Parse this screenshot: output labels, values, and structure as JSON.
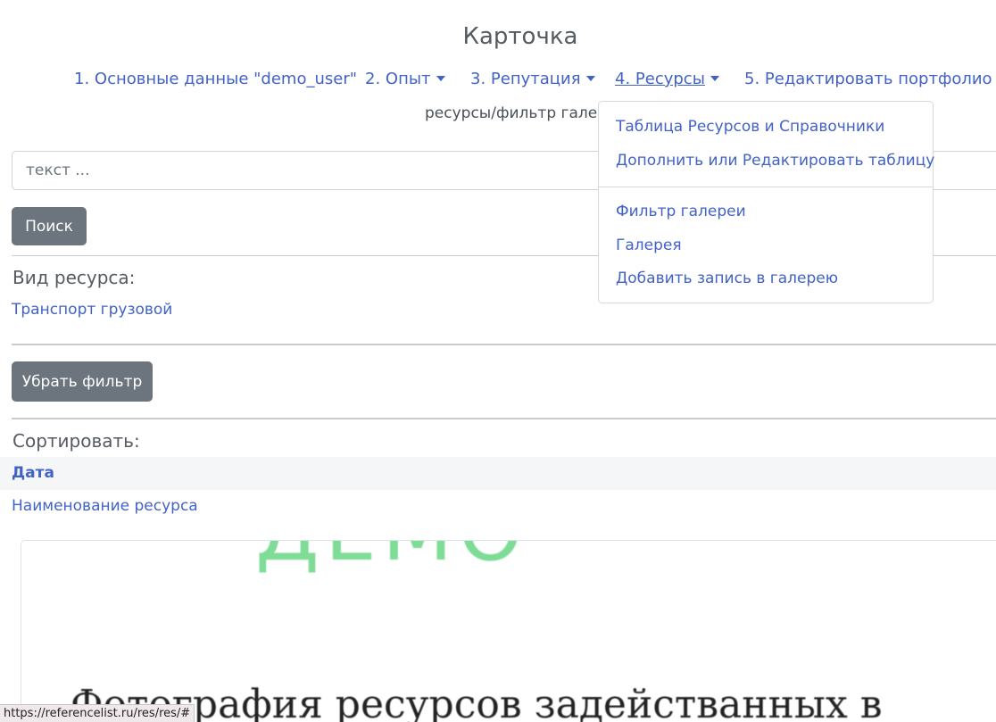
{
  "page": {
    "title": "Карточка",
    "breadcrumb": "ресурсы/фильтр галереи"
  },
  "nav": {
    "items": [
      {
        "label": "1. Основные данные \"demo_user\""
      },
      {
        "label": "2. Опыт"
      },
      {
        "label": "3. Репутация"
      },
      {
        "label": "4. Ресурсы"
      },
      {
        "label": "5. Редактировать портфолио"
      }
    ]
  },
  "dropdown": {
    "items": [
      {
        "label": "Таблица Ресурсов и Справочники"
      },
      {
        "label": "Дополнить или Редактировать таблицу"
      },
      {
        "label": "Фильтр галереи"
      },
      {
        "label": "Галерея"
      },
      {
        "label": "Добавить запись в галерею"
      }
    ]
  },
  "search": {
    "placeholder": "текст ...",
    "button_label": "Поиск"
  },
  "filter": {
    "type_label": "Вид ресурса:",
    "type_value": "Транспорт грузовой",
    "clear_label": "Убрать фильтр"
  },
  "sort": {
    "label": "Сортировать:",
    "options": [
      {
        "label": "Дата",
        "active": true
      },
      {
        "label": "Наименование ресурса",
        "active": false
      }
    ]
  },
  "card": {
    "image_text_top": "ДЕМО",
    "image_caption": "Фотография ресурсов задействанных в"
  },
  "statusbar": {
    "url": "https://referencelist.ru/res/res/#"
  },
  "colors": {
    "link": "#4262c5",
    "button_bg": "#6c757d",
    "watermark": "#7edc97"
  }
}
